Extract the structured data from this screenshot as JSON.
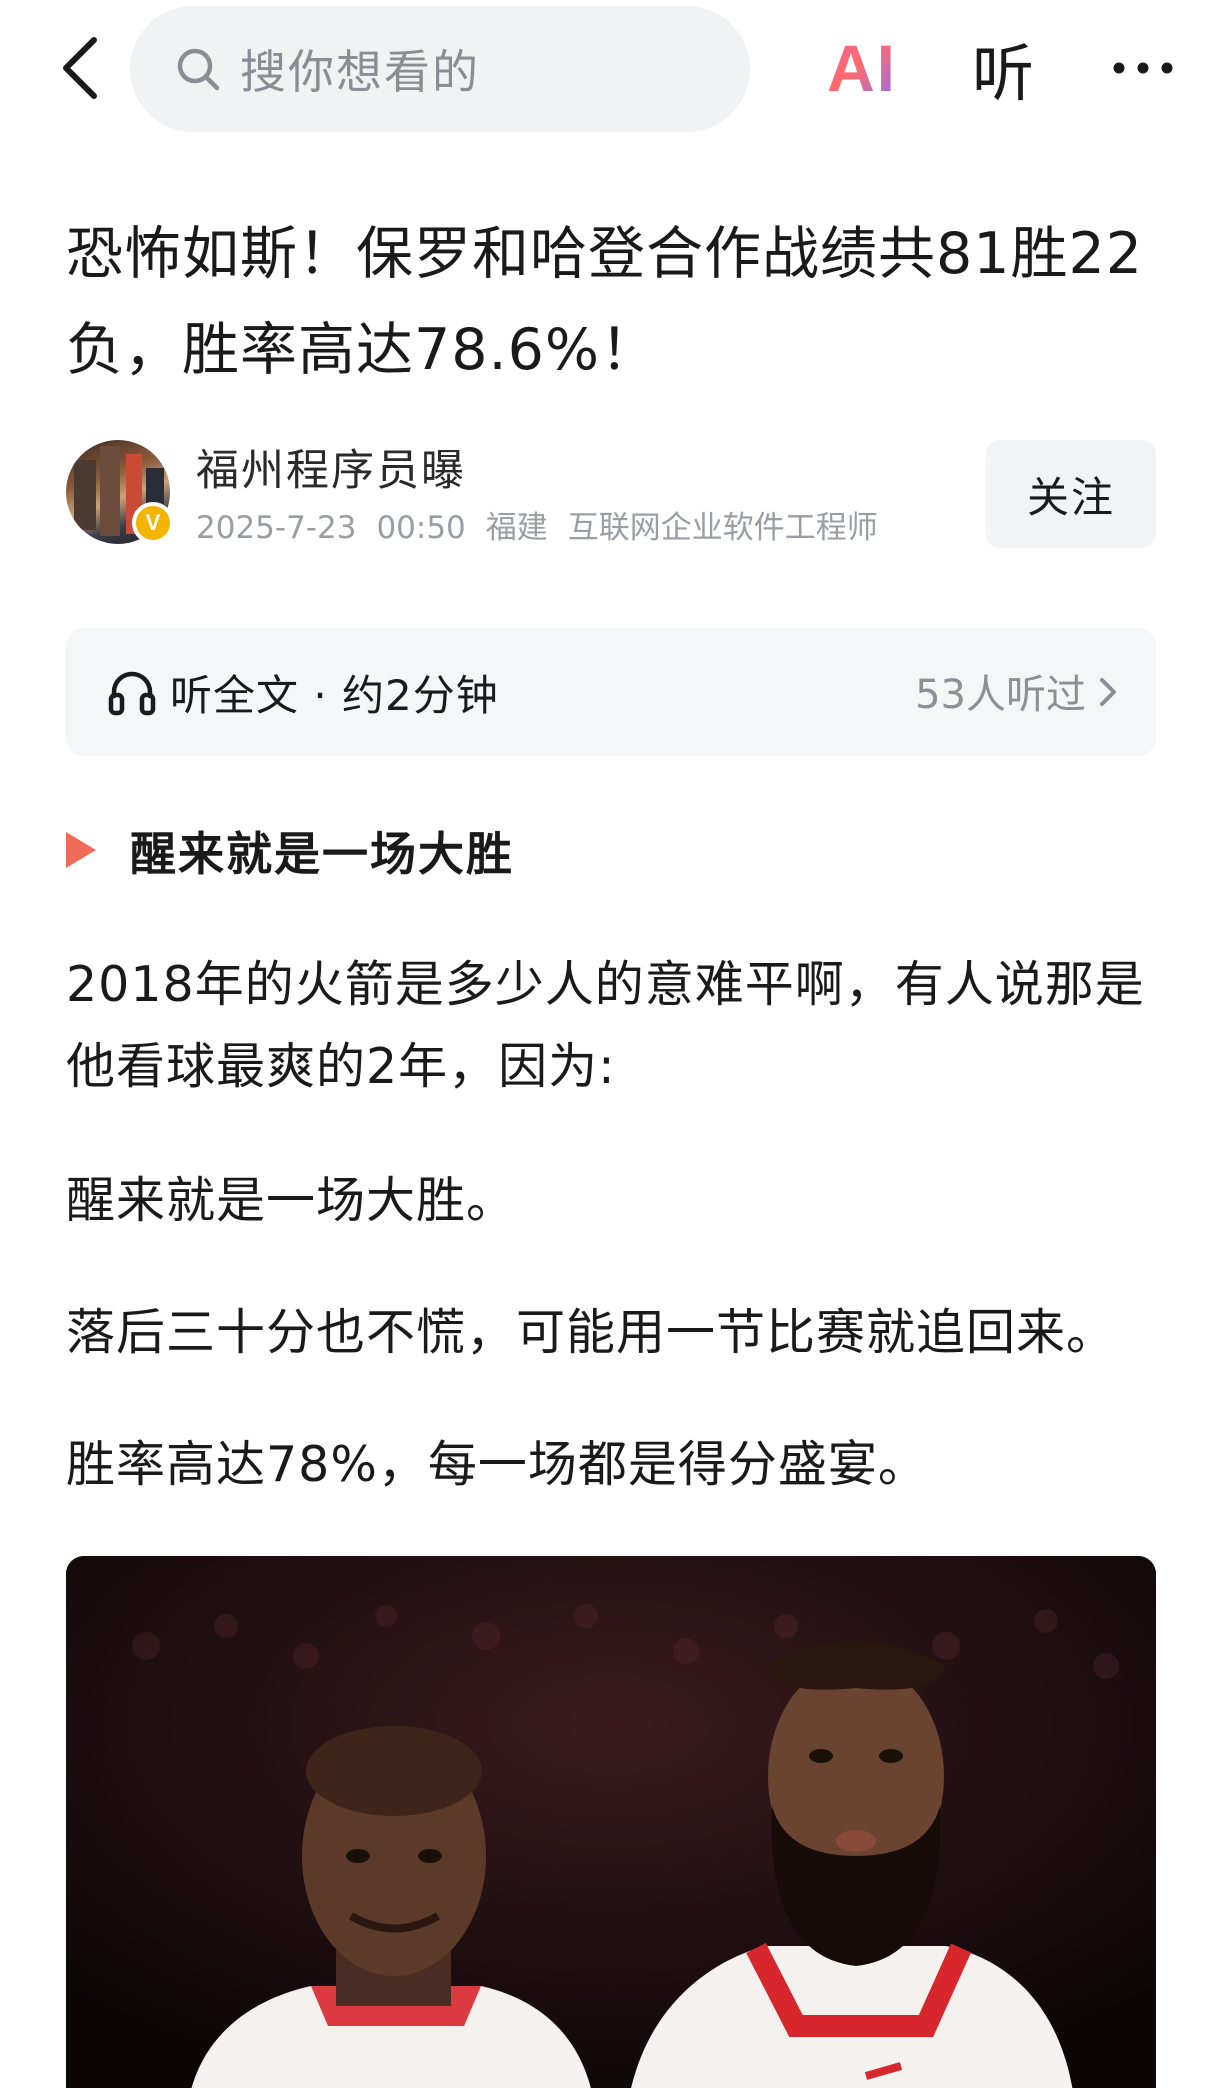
{
  "nav": {
    "search_placeholder": "搜你想看的",
    "ai_label": "AI",
    "listen_label": "听"
  },
  "article": {
    "title": "恐怖如斯！保罗和哈登合作战绩共81胜22负，胜率高达78.6%！",
    "author": {
      "name": "福州程序员曝",
      "date": "2025-7-23",
      "time": "00:50",
      "location": "福建",
      "profession": "互联网企业软件工程师",
      "verified_mark": "V",
      "follow_label": "关注"
    },
    "listen_bar": {
      "label": "听全文 · 约2分钟",
      "count": "53人听过"
    },
    "section_title": "醒来就是一场大胜",
    "paragraphs": [
      "2018年的火箭是多少人的意难平啊，有人说那是他看球最爽的2年，因为:",
      "醒来就是一场大胜。",
      "落后三十分也不慌，可能用一节比赛就追回来。",
      "胜率高达78%，每一场都是得分盛宴。"
    ]
  },
  "colors": {
    "accent_marker": "#f06a5a",
    "verified_badge": "#f5b400",
    "jersey_red": "#d8262d"
  },
  "icons": [
    "chevron-left-icon",
    "search-icon",
    "more-icon",
    "headphone-icon",
    "chevron-right-icon",
    "play-triangle-icon"
  ]
}
